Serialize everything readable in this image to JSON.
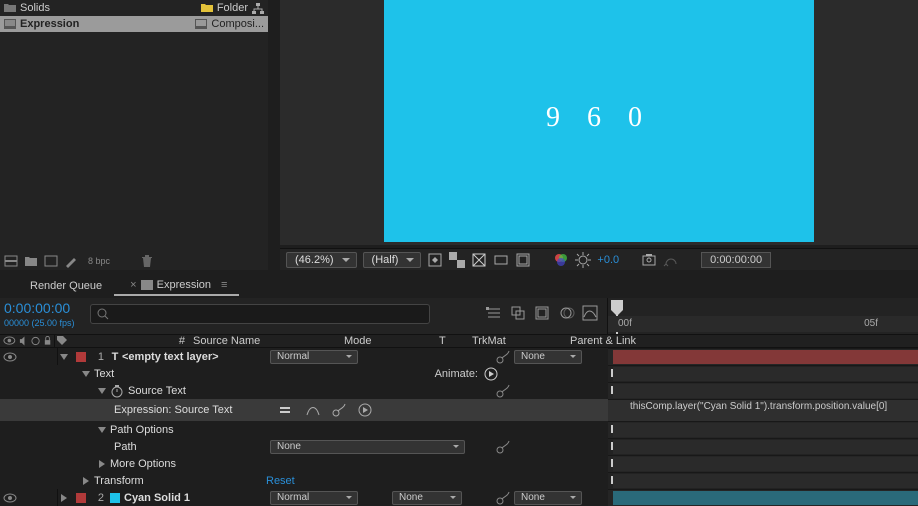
{
  "project": {
    "items": [
      {
        "name": "Solids",
        "type": "Folder"
      },
      {
        "name": "Expression",
        "type": "Composi..."
      }
    ],
    "bpc": "8 bpc"
  },
  "viewer": {
    "canvas_text": "9 6 0",
    "zoom": "(46.2%)",
    "resolution": "(Half)",
    "exposure": "+0.0",
    "timecode": "0:00:00:00"
  },
  "tabs": {
    "render_queue": "Render Queue",
    "active": "Expression"
  },
  "timeline": {
    "current_tc": "0:00:00:00",
    "current_sub": "00000 (25.00 fps)",
    "ruler": {
      "start": "00f",
      "end": "05f"
    },
    "col_headers": {
      "num": "#",
      "src": "Source Name",
      "mode": "Mode",
      "t": "T",
      "trkmat": "TrkMat",
      "parent": "Parent & Link"
    },
    "layers": [
      {
        "num": "1",
        "label_color": "#b13a3a",
        "type_color": "#ffffff",
        "type": "T",
        "name": "<empty text layer>",
        "mode": "Normal",
        "parent": "None",
        "bar": "red"
      },
      {
        "num": "2",
        "label_color": "#b13a3a",
        "type_color": "#1ec2ea",
        "name": "Cyan Solid 1",
        "mode": "Normal",
        "parent": "None",
        "bar": "cyan"
      }
    ],
    "text_group": {
      "label": "Text",
      "animate": "Animate:",
      "source_text": "Source Text",
      "expression_label": "Expression: Source Text",
      "path_options": "Path Options",
      "path": "Path",
      "path_value": "None",
      "more_options": "More Options",
      "transform": "Transform",
      "reset": "Reset",
      "expression_code": "thisComp.layer(\"Cyan Solid 1\").transform.position.value[0]"
    }
  }
}
